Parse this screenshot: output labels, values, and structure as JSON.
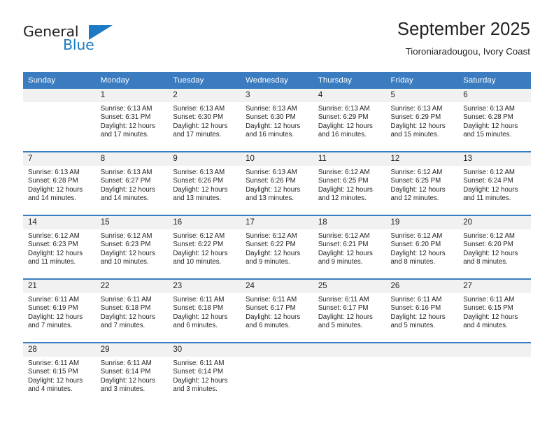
{
  "logo": {
    "word_top": "General",
    "word_bottom": "Blue",
    "accent_color": "#1a7bc4"
  },
  "header": {
    "title": "September 2025",
    "location": "Tioroniaradougou, Ivory Coast"
  },
  "theme": {
    "header_blue": "#3b7cc0",
    "daynum_band": "#f1f1f1",
    "text": "#231f20"
  },
  "calendar": {
    "weekday_headers": [
      "Sunday",
      "Monday",
      "Tuesday",
      "Wednesday",
      "Thursday",
      "Friday",
      "Saturday"
    ],
    "labels": {
      "sunrise_prefix": "Sunrise:",
      "sunset_prefix": "Sunset:",
      "daylight_prefix": "Daylight:"
    },
    "weeks": [
      [
        {
          "day": "",
          "blank": true,
          "line1": "",
          "line2": "",
          "line3": "",
          "line4": ""
        },
        {
          "day": "1",
          "line1": "Sunrise: 6:13 AM",
          "line2": "Sunset: 6:31 PM",
          "line3": "Daylight: 12 hours",
          "line4": "and 17 minutes."
        },
        {
          "day": "2",
          "line1": "Sunrise: 6:13 AM",
          "line2": "Sunset: 6:30 PM",
          "line3": "Daylight: 12 hours",
          "line4": "and 17 minutes."
        },
        {
          "day": "3",
          "line1": "Sunrise: 6:13 AM",
          "line2": "Sunset: 6:30 PM",
          "line3": "Daylight: 12 hours",
          "line4": "and 16 minutes."
        },
        {
          "day": "4",
          "line1": "Sunrise: 6:13 AM",
          "line2": "Sunset: 6:29 PM",
          "line3": "Daylight: 12 hours",
          "line4": "and 16 minutes."
        },
        {
          "day": "5",
          "line1": "Sunrise: 6:13 AM",
          "line2": "Sunset: 6:29 PM",
          "line3": "Daylight: 12 hours",
          "line4": "and 15 minutes."
        },
        {
          "day": "6",
          "line1": "Sunrise: 6:13 AM",
          "line2": "Sunset: 6:28 PM",
          "line3": "Daylight: 12 hours",
          "line4": "and 15 minutes."
        }
      ],
      [
        {
          "day": "7",
          "line1": "Sunrise: 6:13 AM",
          "line2": "Sunset: 6:28 PM",
          "line3": "Daylight: 12 hours",
          "line4": "and 14 minutes."
        },
        {
          "day": "8",
          "line1": "Sunrise: 6:13 AM",
          "line2": "Sunset: 6:27 PM",
          "line3": "Daylight: 12 hours",
          "line4": "and 14 minutes."
        },
        {
          "day": "9",
          "line1": "Sunrise: 6:13 AM",
          "line2": "Sunset: 6:26 PM",
          "line3": "Daylight: 12 hours",
          "line4": "and 13 minutes."
        },
        {
          "day": "10",
          "line1": "Sunrise: 6:13 AM",
          "line2": "Sunset: 6:26 PM",
          "line3": "Daylight: 12 hours",
          "line4": "and 13 minutes."
        },
        {
          "day": "11",
          "line1": "Sunrise: 6:12 AM",
          "line2": "Sunset: 6:25 PM",
          "line3": "Daylight: 12 hours",
          "line4": "and 12 minutes."
        },
        {
          "day": "12",
          "line1": "Sunrise: 6:12 AM",
          "line2": "Sunset: 6:25 PM",
          "line3": "Daylight: 12 hours",
          "line4": "and 12 minutes."
        },
        {
          "day": "13",
          "line1": "Sunrise: 6:12 AM",
          "line2": "Sunset: 6:24 PM",
          "line3": "Daylight: 12 hours",
          "line4": "and 11 minutes."
        }
      ],
      [
        {
          "day": "14",
          "line1": "Sunrise: 6:12 AM",
          "line2": "Sunset: 6:23 PM",
          "line3": "Daylight: 12 hours",
          "line4": "and 11 minutes."
        },
        {
          "day": "15",
          "line1": "Sunrise: 6:12 AM",
          "line2": "Sunset: 6:23 PM",
          "line3": "Daylight: 12 hours",
          "line4": "and 10 minutes."
        },
        {
          "day": "16",
          "line1": "Sunrise: 6:12 AM",
          "line2": "Sunset: 6:22 PM",
          "line3": "Daylight: 12 hours",
          "line4": "and 10 minutes."
        },
        {
          "day": "17",
          "line1": "Sunrise: 6:12 AM",
          "line2": "Sunset: 6:22 PM",
          "line3": "Daylight: 12 hours",
          "line4": "and 9 minutes."
        },
        {
          "day": "18",
          "line1": "Sunrise: 6:12 AM",
          "line2": "Sunset: 6:21 PM",
          "line3": "Daylight: 12 hours",
          "line4": "and 9 minutes."
        },
        {
          "day": "19",
          "line1": "Sunrise: 6:12 AM",
          "line2": "Sunset: 6:20 PM",
          "line3": "Daylight: 12 hours",
          "line4": "and 8 minutes."
        },
        {
          "day": "20",
          "line1": "Sunrise: 6:12 AM",
          "line2": "Sunset: 6:20 PM",
          "line3": "Daylight: 12 hours",
          "line4": "and 8 minutes."
        }
      ],
      [
        {
          "day": "21",
          "line1": "Sunrise: 6:11 AM",
          "line2": "Sunset: 6:19 PM",
          "line3": "Daylight: 12 hours",
          "line4": "and 7 minutes."
        },
        {
          "day": "22",
          "line1": "Sunrise: 6:11 AM",
          "line2": "Sunset: 6:18 PM",
          "line3": "Daylight: 12 hours",
          "line4": "and 7 minutes."
        },
        {
          "day": "23",
          "line1": "Sunrise: 6:11 AM",
          "line2": "Sunset: 6:18 PM",
          "line3": "Daylight: 12 hours",
          "line4": "and 6 minutes."
        },
        {
          "day": "24",
          "line1": "Sunrise: 6:11 AM",
          "line2": "Sunset: 6:17 PM",
          "line3": "Daylight: 12 hours",
          "line4": "and 6 minutes."
        },
        {
          "day": "25",
          "line1": "Sunrise: 6:11 AM",
          "line2": "Sunset: 6:17 PM",
          "line3": "Daylight: 12 hours",
          "line4": "and 5 minutes."
        },
        {
          "day": "26",
          "line1": "Sunrise: 6:11 AM",
          "line2": "Sunset: 6:16 PM",
          "line3": "Daylight: 12 hours",
          "line4": "and 5 minutes."
        },
        {
          "day": "27",
          "line1": "Sunrise: 6:11 AM",
          "line2": "Sunset: 6:15 PM",
          "line3": "Daylight: 12 hours",
          "line4": "and 4 minutes."
        }
      ],
      [
        {
          "day": "28",
          "line1": "Sunrise: 6:11 AM",
          "line2": "Sunset: 6:15 PM",
          "line3": "Daylight: 12 hours",
          "line4": "and 4 minutes."
        },
        {
          "day": "29",
          "line1": "Sunrise: 6:11 AM",
          "line2": "Sunset: 6:14 PM",
          "line3": "Daylight: 12 hours",
          "line4": "and 3 minutes."
        },
        {
          "day": "30",
          "line1": "Sunrise: 6:11 AM",
          "line2": "Sunset: 6:14 PM",
          "line3": "Daylight: 12 hours",
          "line4": "and 3 minutes."
        },
        {
          "day": "",
          "blank": true,
          "line1": "",
          "line2": "",
          "line3": "",
          "line4": ""
        },
        {
          "day": "",
          "blank": true,
          "line1": "",
          "line2": "",
          "line3": "",
          "line4": ""
        },
        {
          "day": "",
          "blank": true,
          "line1": "",
          "line2": "",
          "line3": "",
          "line4": ""
        },
        {
          "day": "",
          "blank": true,
          "line1": "",
          "line2": "",
          "line3": "",
          "line4": ""
        }
      ]
    ]
  }
}
